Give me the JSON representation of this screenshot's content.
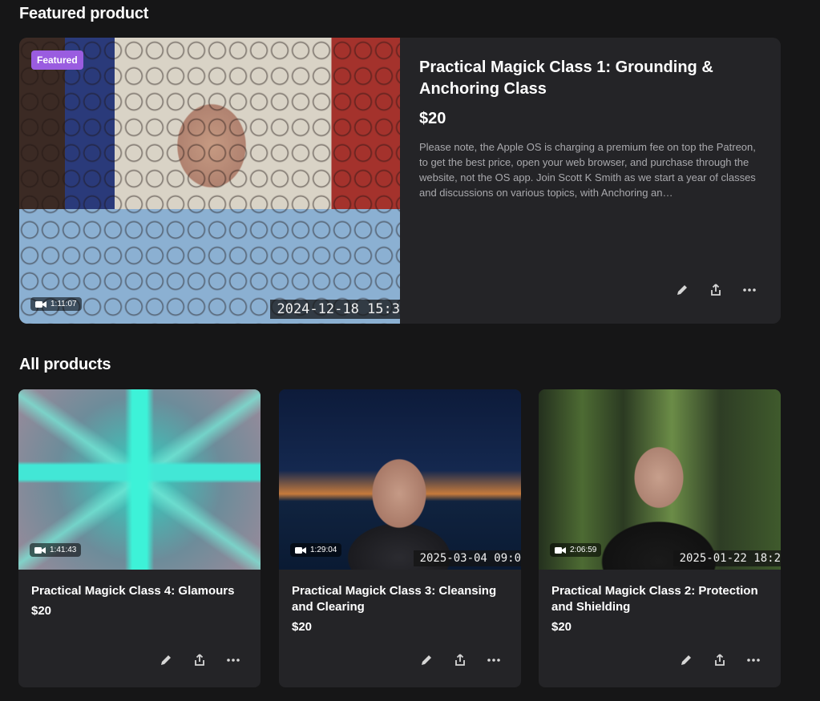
{
  "featured_section": {
    "heading": "Featured product",
    "product": {
      "badge": "Featured",
      "title": "Practical Magick Class 1: Grounding & Anchoring Class",
      "price": "$20",
      "description": "Please note, the Apple OS is charging a premium fee on top the Patreon, to get the best price, open your web browser, and purchase through the website, not the OS app. Join Scott K Smith as we start a year of classes and discussions on various topics, with Anchoring an…",
      "duration": "1:11:07",
      "timestamp": "2024-12-18 15:3"
    }
  },
  "all_products": {
    "heading": "All products",
    "items": [
      {
        "title": "Practical Magick Class 4: Glamours",
        "price": "$20",
        "duration": "1:41:43",
        "timestamp": ""
      },
      {
        "title": "Practical Magick Class 3: Cleansing and Clearing",
        "price": "$20",
        "duration": "1:29:04",
        "timestamp": "2025-03-04 09:0"
      },
      {
        "title": "Practical Magick Class 2: Protection and Shielding",
        "price": "$20",
        "duration": "2:06:59",
        "timestamp": "2025-01-22 18:2"
      }
    ]
  },
  "icons": {
    "edit": "pencil-icon",
    "share": "share-icon",
    "more": "more-horizontal-icon",
    "video": "video-camera-icon"
  },
  "colors": {
    "background": "#161617",
    "card": "#242427",
    "badge": "#9a5ce0",
    "muted_text": "#a9a9ad"
  }
}
